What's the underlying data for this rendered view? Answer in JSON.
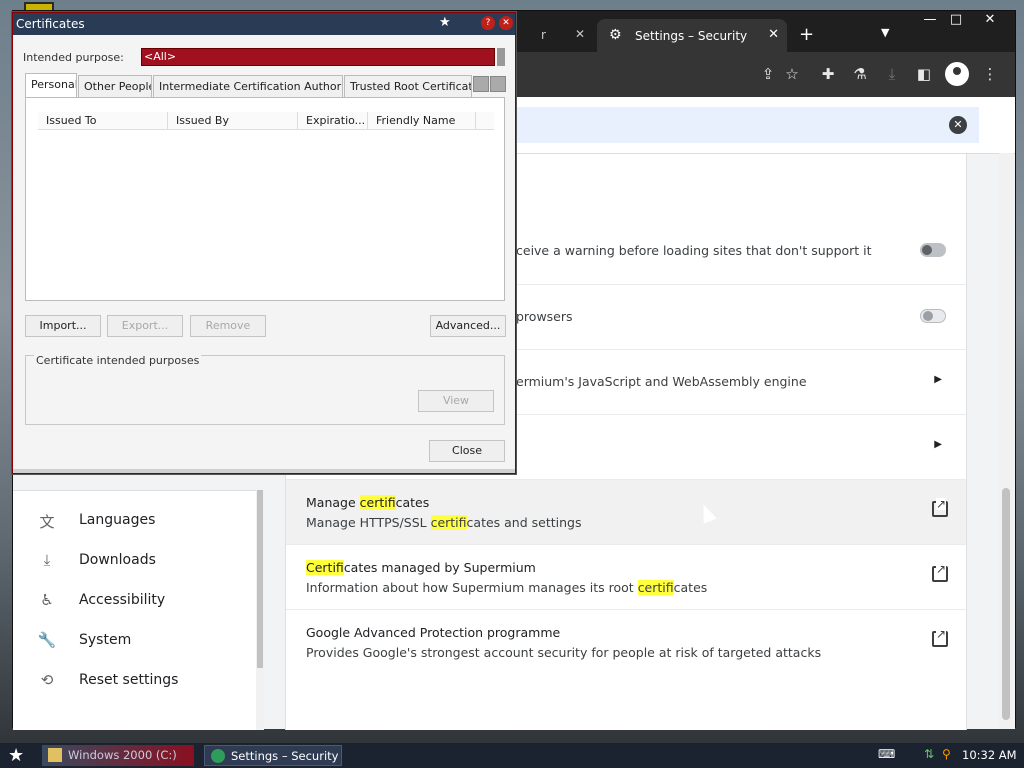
{
  "browser": {
    "tabs": [
      {
        "label": "r",
        "active": false
      },
      {
        "label": "Settings – Security",
        "active": true
      }
    ],
    "new_tab_label": "+",
    "search_value": ""
  },
  "sidebar": {
    "items": [
      {
        "icon": "translate-icon",
        "glyph": "文",
        "label": "Languages"
      },
      {
        "icon": "download-icon",
        "glyph": "⤓",
        "label": "Downloads"
      },
      {
        "icon": "accessibility-icon",
        "glyph": "♿",
        "label": "Accessibility"
      },
      {
        "icon": "wrench-icon",
        "glyph": "🔧",
        "label": "System"
      },
      {
        "icon": "reset-icon",
        "glyph": "⟲",
        "label": "Reset settings"
      }
    ]
  },
  "settings": {
    "row_https_text": "ceive a warning before loading sites that don't support it",
    "row_browsers_text": "prowsers",
    "row_v8_text": "ermium's JavaScript and WebAssembly engine",
    "manage": {
      "t1_pre": "Manage ",
      "t1_hl": "certif",
      "t1_post": "icates",
      "t2_pre": "Manage HTTPS/SSL ",
      "t2_hl": "certif",
      "t2_post": "icates and settings"
    },
    "managed": {
      "t1_hl": "Certif",
      "t1_post": "icates managed by Supermium",
      "t2_pre": "Information about how Supermium manages its root ",
      "t2_hl": "certif",
      "t2_post": "icates"
    },
    "gapp": {
      "t1": "Google Advanced Protection programme",
      "t2": "Provides Google's strongest account security for people at risk of targeted attacks"
    }
  },
  "dialog": {
    "title": "Certificates",
    "intended_purpose_label": "Intended purpose:",
    "intended_purpose_value": "<All>",
    "tabs": [
      "Personal",
      "Other People",
      "Intermediate Certification Authorities",
      "Trusted Root Certification"
    ],
    "columns": [
      "Issued To",
      "Issued By",
      "Expiratio...",
      "Friendly Name"
    ],
    "buttons": {
      "import": "Import...",
      "export": "Export...",
      "remove": "Remove",
      "advanced": "Advanced...",
      "view": "View",
      "close": "Close"
    },
    "purposes_label": "Certificate intended purposes"
  },
  "taskbar": {
    "task1": "Windows 2000 (C:)",
    "task2": "Settings – Security ...",
    "clock": "10:32 AM"
  }
}
